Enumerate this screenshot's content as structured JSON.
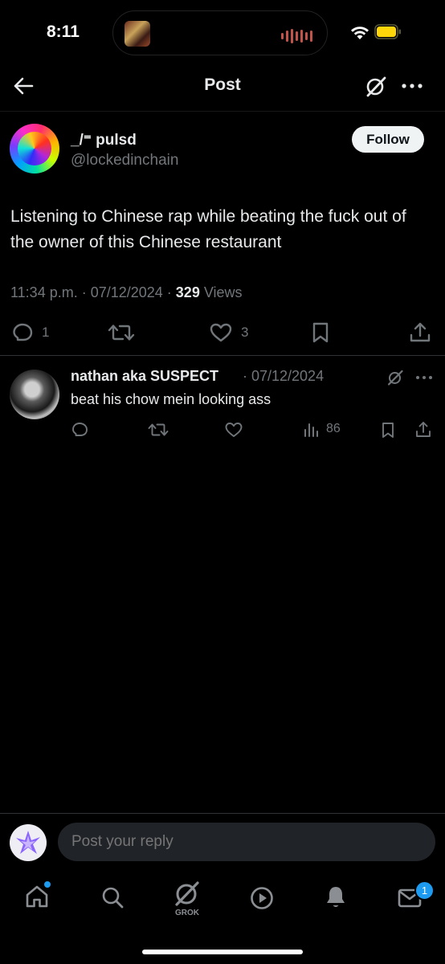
{
  "status_bar": {
    "time": "8:11"
  },
  "header": {
    "title": "Post"
  },
  "post": {
    "display_name": "_/⁼ pulsd",
    "handle": "@lockedinchain",
    "follow_label": "Follow",
    "text": "Listening to Chinese rap while beating the fuck out of the owner of this Chinese restaurant",
    "timestamp": "11:34 p.m. · 07/12/2024 · ",
    "views_count": "329",
    "views_label": " Views",
    "reply_count": "1",
    "like_count": "3"
  },
  "reply": {
    "display_name": "nathan aka SUSPECT",
    "date": "· 07/12/2024",
    "text": "beat his chow mein looking ass",
    "views": "86"
  },
  "composer": {
    "placeholder": "Post your reply"
  },
  "bottom_nav": {
    "items": [
      "home-icon",
      "search-icon",
      "grok-icon",
      "video-icon",
      "notifications-icon",
      "messages-icon"
    ],
    "grok_label": "GROK",
    "messages_badge": "1"
  },
  "colors": {
    "accent": "#1d9bf0",
    "secondary_text": "#71767b",
    "background": "#000000"
  }
}
